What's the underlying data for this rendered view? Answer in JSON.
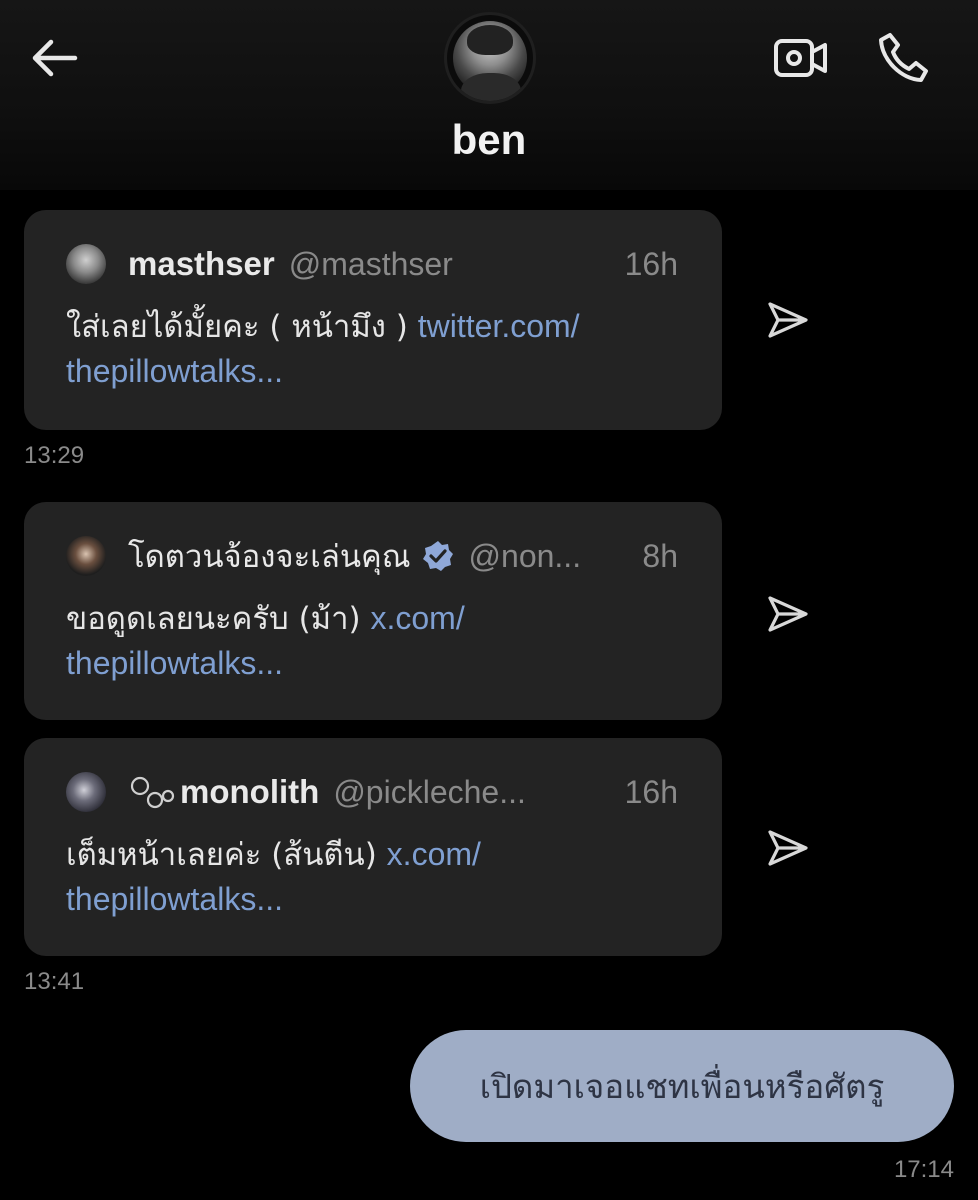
{
  "header": {
    "contact_name": "ben",
    "back_icon": "back-arrow-icon",
    "video_icon": "video-call-icon",
    "call_icon": "phone-icon"
  },
  "messages": [
    {
      "display_name": "masthser",
      "handle": "@masthser",
      "time": "16h",
      "text": "ใส่เลยได้มั้ยคะ ( หน้ามึง ) ",
      "link_part1": "twitter.com/",
      "link_part2": "thepillowtalks..."
    },
    {
      "display_name": "โดตวนจ้องจะเล่นคุณ",
      "handle": "@non...",
      "time": "8h",
      "verified": true,
      "text": "ขอดูดเลยนะครับ (ม้า) ",
      "link_part1": "x.com/",
      "link_part2": "thepillowtalks..."
    },
    {
      "display_name": "monolith",
      "handle": "@pickleche...",
      "time": "16h",
      "text": "เต็มหน้าเลยค่ะ (ส้นตีน) ",
      "link_part1": "x.com/",
      "link_part2": "thepillowtalks..."
    }
  ],
  "timestamps": {
    "first": "13:29",
    "second": "13:41",
    "mine": "17:14"
  },
  "my_message": "เปิดมาเจอแชทเพื่อนหรือศัตรู",
  "colors": {
    "background": "#000000",
    "card": "#232323",
    "link": "#7f9fd1",
    "my_bubble": "#9fadc6",
    "verified": "#8fa8d8"
  }
}
